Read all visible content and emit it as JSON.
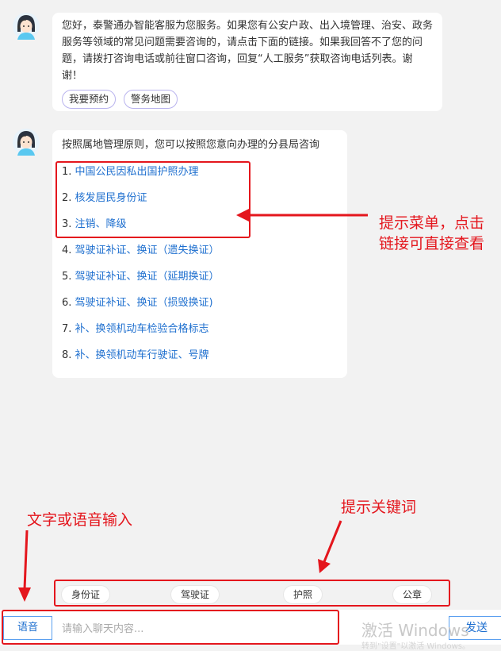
{
  "messages": {
    "welcome": {
      "text": "您好，泰警通办智能客服为您服务。如果您有公安户政、出入境管理、治安、政务服务等领域的常见问题需要咨询的，请点击下面的链接。如果我回答不了您的问题，请拨打咨询电话或前往窗口咨询，回复“人工服务”获取咨询电话列表。谢谢！",
      "buttons": [
        "我要预约",
        "警务地图"
      ]
    },
    "menu": {
      "intro": "按照属地管理原则，您可以按照您意向办理的分县局咨询",
      "items": [
        {
          "num": "1.",
          "label": "中国公民因私出国护照办理"
        },
        {
          "num": "2.",
          "label": "核发居民身份证"
        },
        {
          "num": "3.",
          "label": "注销、降级"
        },
        {
          "num": "4.",
          "label": "驾驶证补证、换证（遗失换证）"
        },
        {
          "num": "5.",
          "label": "驾驶证补证、换证（延期换证）"
        },
        {
          "num": "6.",
          "label": "驾驶证补证、换证（损毁换证)"
        },
        {
          "num": "7.",
          "label": "补、换领机动车检验合格标志"
        },
        {
          "num": "8.",
          "label": "补、换领机动车行驶证、号牌"
        }
      ]
    }
  },
  "annotations": {
    "menu_hint": "提示菜单，点击链接可直接查看",
    "keyword_hint": "提示关键词",
    "input_hint": "文字或语音输入"
  },
  "keywords": [
    "身份证",
    "驾驶证",
    "护照",
    "公章"
  ],
  "input_bar": {
    "voice_label": "语音",
    "placeholder": "请输入聊天内容...",
    "send_label": "发送"
  },
  "watermark": {
    "line1": "激活 Windows",
    "line2": "转到\"设置\"以激活 Windows。"
  },
  "colors": {
    "annotation_red": "#e4161d",
    "link_blue": "#1e6fcf",
    "pill_border": "#b9b3ee"
  }
}
